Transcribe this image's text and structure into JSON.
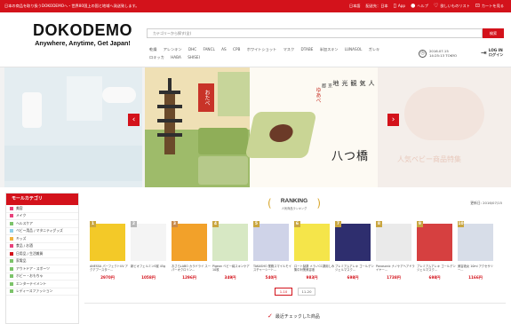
{
  "topbar": {
    "notice": "日本の商品を取り扱うDOKODEMOへ・世界80国上の国と地域へ発送致します。",
    "language": "日本語",
    "ship_to": "配送先：日本",
    "app": "App",
    "help": "ヘルプ",
    "wishlist": "欲しいものリスト",
    "cart": "カートを見る"
  },
  "header": {
    "logo_name": "DOKODEMO",
    "logo_tagline": "Anywhere, Anytime, Get Japan!",
    "search_placeholder": "カテゴリーから探す(全)",
    "search_button": "検索",
    "keywords": [
      "乾燥",
      "アレンキン",
      "DHC",
      "FANCL",
      "AS",
      "CPB",
      "ホワイトショット",
      "マスク",
      "DTABE",
      "半加スキン",
      "LUNASOL",
      "ガレキ",
      "ロキッカ",
      "HABA",
      "SHISEI"
    ],
    "date": "2016.07.15",
    "time": "14:25:13 TOKYO",
    "login_en": "LOG IN",
    "login_ja": "ログイン"
  },
  "banner": {
    "prev_icon": "‹",
    "next_icon": "›",
    "brand_label": "おたべ",
    "title": "八つ橋",
    "subtitle": "人気観光地",
    "place": "京都",
    "seal": "ゆあべ",
    "right_teaser": "人気ベビー商品特集"
  },
  "categories": {
    "title": "モールカテゴリ",
    "items": [
      {
        "label": "美容",
        "color": "#e8417a"
      },
      {
        "label": "メイク",
        "color": "#e8417a"
      },
      {
        "label": "ヘルスケア",
        "color": "#7cc36a"
      },
      {
        "label": "ベビー用品 / マタニティグッズ",
        "color": "#8fd0e8"
      },
      {
        "label": "キッズ",
        "color": "#f0b23d"
      },
      {
        "label": "食品 / お酒",
        "color": "#e8417a"
      },
      {
        "label": "日用品 / 生活雑貨",
        "color": "#d3121b"
      },
      {
        "label": "家電品",
        "color": "#7cc36a"
      },
      {
        "label": "アウトドア・スポーツ",
        "color": "#7cc36a"
      },
      {
        "label": "ホビー・おもちゃ",
        "color": "#7cc36a"
      },
      {
        "label": "エンターテイメント",
        "color": "#7cc36a"
      },
      {
        "label": "レディースファッション",
        "color": "#7cc36a"
      }
    ]
  },
  "ranking": {
    "title": "RANKING",
    "subtitle": "人気商品ランキング",
    "updated": "更新日: 2016/07/15",
    "products": [
      {
        "rank": "1",
        "desc": "ANESSA パーフェクトUV アクアブースター...",
        "price": "2970円",
        "img": "#f3c928",
        "badge": "#c9a640"
      },
      {
        "rank": "2",
        "desc": "新ビオフェルミンS錠 45g",
        "price": "1058円",
        "img": "#f4f4f4",
        "badge": "#b8b8b8"
      },
      {
        "rank": "3",
        "desc": "おさらLABO カラドライ スーパーオクロリン...",
        "price": "1296円",
        "img": "#f2a12a",
        "badge": "#c88a4c"
      },
      {
        "rank": "4",
        "desc": "Pigeon ベビー綿スキンケア 10枚",
        "price": "349円",
        "img": "#d7e8c4",
        "badge": "#c9a640"
      },
      {
        "rank": "5",
        "desc": "TAKASHO 業務スマイルモイスチャーシート...",
        "price": "540円",
        "img": "#cfd3e8",
        "badge": "#c9a640"
      },
      {
        "rank": "6",
        "desc": "ロート製薬 メラノCC薬用しみ集中対策美容液",
        "price": "983円",
        "img": "#f5e54a",
        "badge": "#c9a640"
      },
      {
        "rank": "7",
        "desc": "プレミアムアレキ ゴールデンジェルマスク...",
        "price": "698円",
        "img": "#2e2e6e",
        "badge": "#c9a640"
      },
      {
        "rank": "8",
        "desc": "Panasonic ナノケアヘアドライヤー...",
        "price": "1738円",
        "img": "#eaeaea",
        "badge": "#c9a640"
      },
      {
        "rank": "9",
        "desc": "プレミアムアレキ ゴールデンジェルマスク...",
        "price": "698円",
        "img": "#d64040",
        "badge": "#c9a640"
      },
      {
        "rank": "10",
        "desc": "美容液女 10ml アクセサリー...",
        "price": "1166円",
        "img": "#d7dde8",
        "badge": "#c9a640"
      }
    ],
    "page1": "1-10",
    "page2": "11-20"
  },
  "section2": {
    "icon": "✓",
    "title": "最近チェックした商品"
  }
}
